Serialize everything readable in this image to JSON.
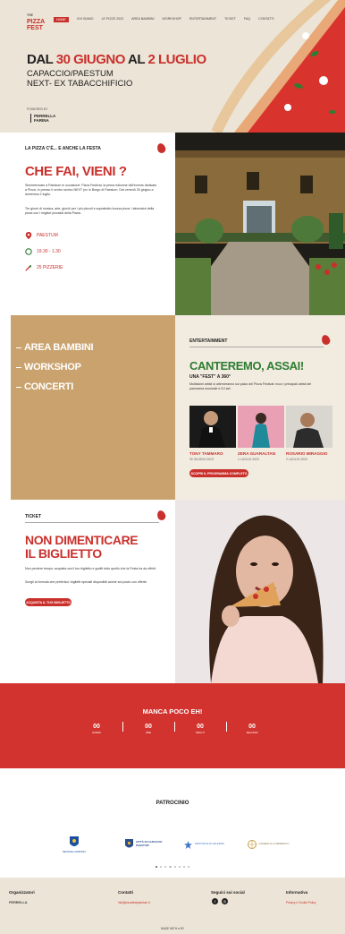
{
  "colors": {
    "accent": "#c9302c",
    "beige": "#ece4d6",
    "tan": "#c9a26e",
    "countdown_bg": "#d2332e"
  },
  "header": {
    "logo_top": "PIZZA",
    "logo_bottom": "FEST",
    "nav": [
      "Home",
      "Chi siamo",
      "Le Pizze 2023",
      "Area Bambini",
      "Workshop",
      "Entertainment",
      "Ticket",
      "FAQ",
      "Contatti"
    ]
  },
  "hero": {
    "date_prefix": "DAL",
    "date_start": "30 GIUGNO",
    "date_mid": "AL",
    "date_end": "2 LUGLIO",
    "place_line1": "CAPACCIO/PAESTUM",
    "place_line2": "NEXT- EX TABACCHIFICIO",
    "sponsor_label": "Powered by",
    "sponsor_name_1": "PERRELLA",
    "sponsor_name_2": "FARINA"
  },
  "intro": {
    "eyebrow": "LA PIZZA C'È... E ANCHE LA FESTA",
    "title": "CHE FAI, VIENI ?",
    "paragraph1": "Simmetrovato a Paestum in occasione: Pizza Festival, la prima edizione dell'evento dedicato a Pizza, in presso il centro storico NEXT (ex in Borgo di Paestum. Dal venerdì 30 giugno a domenica 2 luglio.",
    "paragraph2": "Tre giorni di musica, arte, giochi per i più piccoli e soprattutto buona pizza: i laboratori della pizza con i migliori pizzaioli della Piana.",
    "location": "PAESTUM",
    "hours": "19.30 - 1.30",
    "count": "25 PIZZERIE"
  },
  "activities": {
    "items": [
      "AREA BAMBINI",
      "WORKSHOP",
      "CONCERTI"
    ]
  },
  "entertainment": {
    "eyebrow": "ENTERTAINMENT",
    "title": "CANTEREMO, ASSAI!",
    "subtitle": "UNA \"FEST\" A 360°",
    "paragraph": "Moltissimi artisti si alterneranno sul palco del Pizza Festival: ecco i principali artisti del panorama musicale e DJ set.",
    "artists": [
      {
        "name": "TONY TAMMARO",
        "date": "30 GIUGNO 2023"
      },
      {
        "name": "ZERA GUARALTAN",
        "date": "1 LUGLIO 2023"
      },
      {
        "name": "ROSARIO MIRAGGIO",
        "date": "2 LUGLIO 2023"
      }
    ],
    "button": "SCOPRI IL PROGRAMMA COMPLETO"
  },
  "ticket": {
    "eyebrow": "TICKET",
    "title_line1": "NON DIMENTICARE",
    "title_line2": "IL BIGLIETTO",
    "paragraph1": "Non perdere tempo: acquista ora il tuo biglietto e goditi tutto quello che la Festa ha da offrirti.",
    "paragraph2": "Scegli la formula che preferisci: biglietti speciali disponibili anche sul posto con offerte.",
    "button": "ACQUISTA IL TUO BIGLIETTO"
  },
  "countdown": {
    "title": "MANCA POCO EH!",
    "items": [
      {
        "value": "00",
        "label": "GIORNI"
      },
      {
        "value": "00",
        "label": "ORE"
      },
      {
        "value": "00",
        "label": "MINUTI"
      },
      {
        "value": "00",
        "label": "SECONDI"
      }
    ]
  },
  "patrocinio": {
    "title": "PATROCINIO",
    "logos": [
      "REGIONE CAMPANIA",
      "CITTÀ DI CAPACCIO PAESTUM",
      "PROVINCIA DI SALERNO",
      "CAMERA DI COMMERCIO"
    ]
  },
  "footer": {
    "col1_title": "Organizzatori",
    "col1_text": "PERRELLA",
    "col2_title": "Contatti",
    "col2_link": "info@pizzafestpaestum.it",
    "col3_title": "Seguici sui social",
    "col4_title": "Informativa",
    "col4_link": "Privacy e Cookie Policy",
    "credit": "MADE WITH ♥ BY"
  }
}
